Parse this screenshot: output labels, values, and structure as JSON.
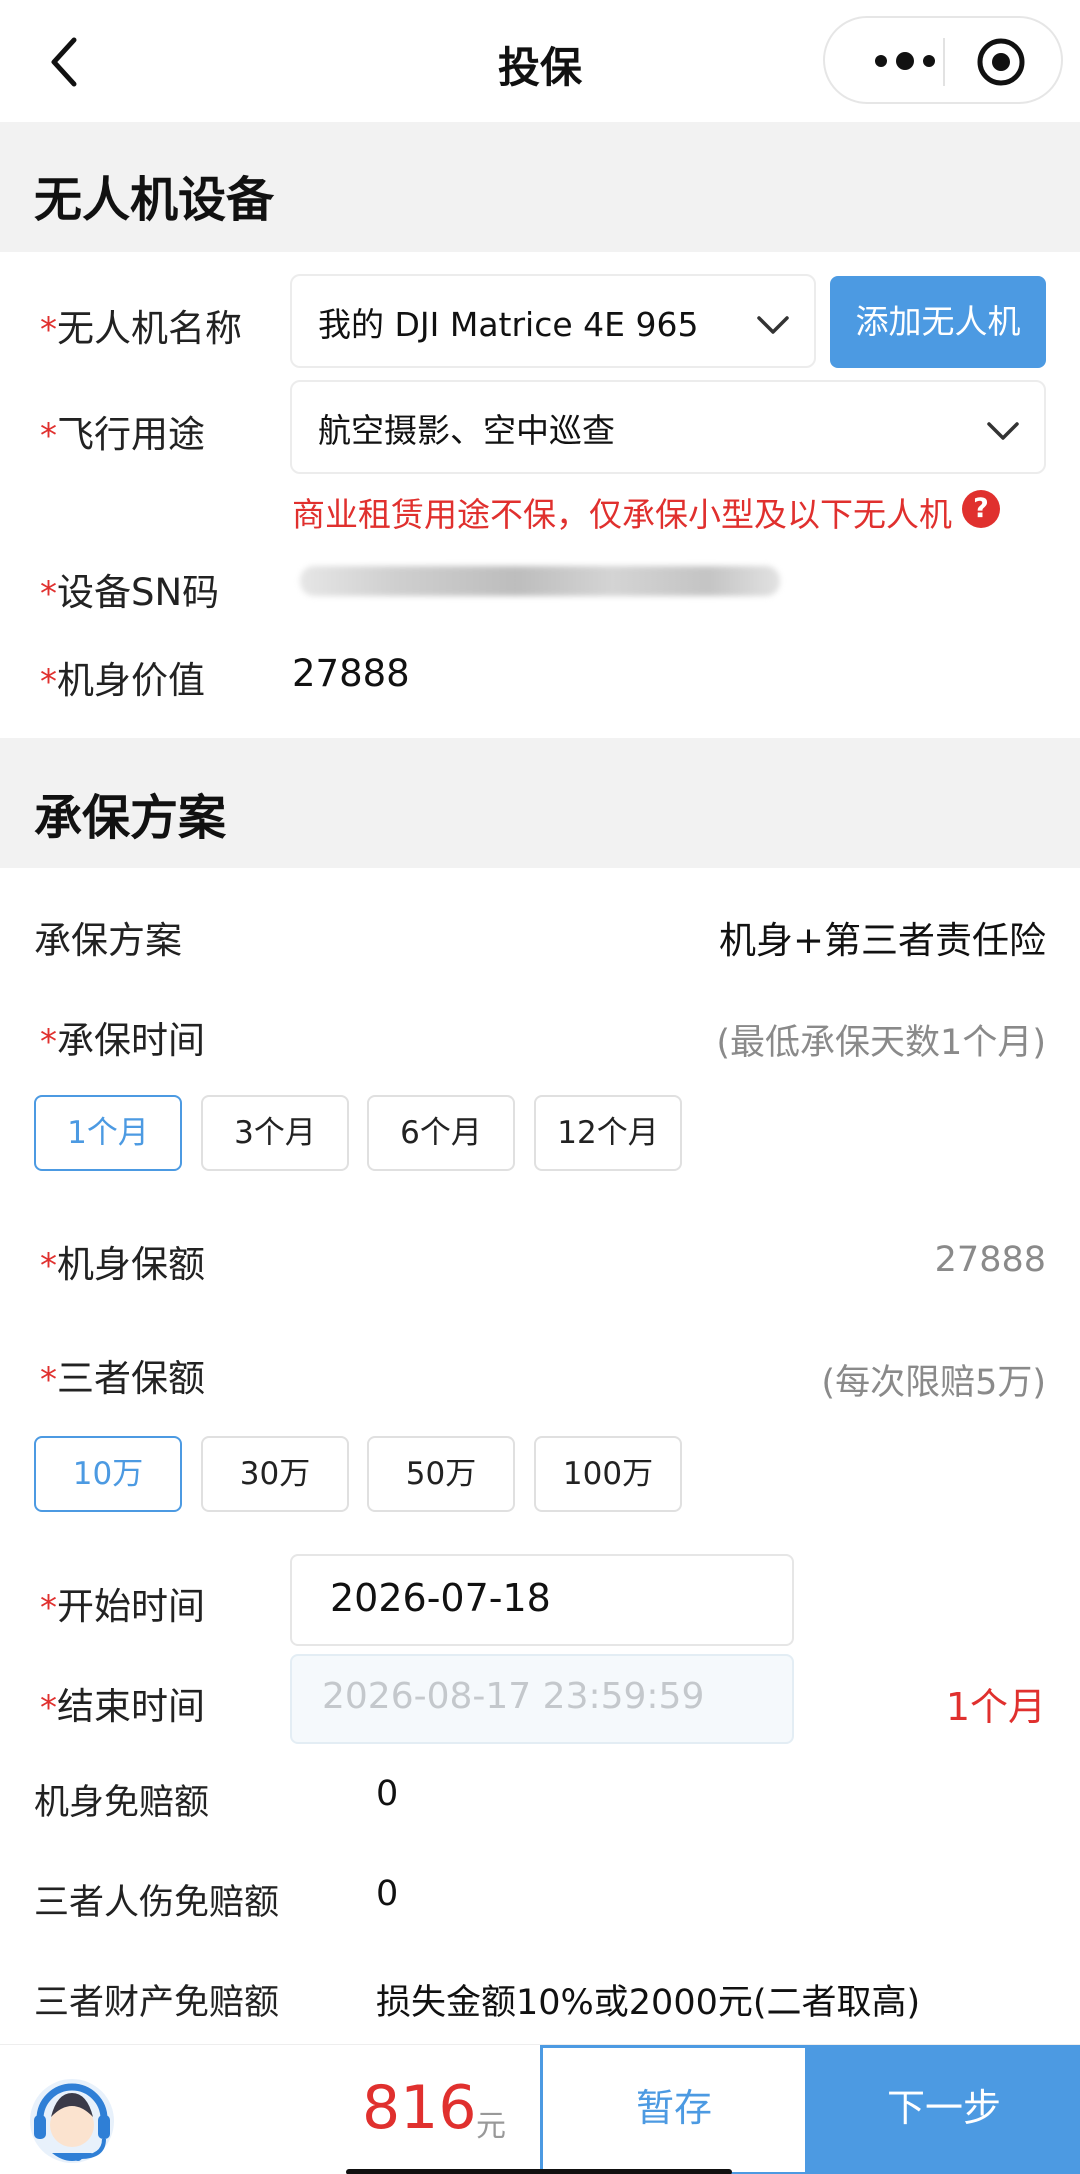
{
  "nav": {
    "title": "投保"
  },
  "device_section": {
    "title": "无人机设备",
    "star": "*",
    "name_label": "无人机名称",
    "name_value": "我的 DJI Matrice 4E 965",
    "add_button": "添加无人机",
    "purpose_label": "飞行用途",
    "purpose_value": "航空摄影、空中巡查",
    "purpose_warning": "商业租赁用途不保，仅承保小型及以下无人机",
    "help_icon_text": "?",
    "sn_label": "设备SN码",
    "value_label": "机身价值",
    "value_value": "27888"
  },
  "plan_section": {
    "title": "承保方案",
    "plan_label": "承保方案",
    "plan_value": "机身+第三者责任险",
    "period_label": "承保时间",
    "period_hint": "(最低承保天数1个月)",
    "period_options": [
      "1个月",
      "3个月",
      "6个月",
      "12个月"
    ],
    "hull_label": "机身保额",
    "hull_value": "27888",
    "third_label": "三者保额",
    "third_hint": "(每次限赔5万)",
    "third_options": [
      "10万",
      "30万",
      "50万",
      "100万"
    ],
    "start_label": "开始时间",
    "start_value": "2026-07-18",
    "end_label": "结束时间",
    "end_value": "2026-08-17 23:59:59",
    "duration": "1个月",
    "hull_deductible_label": "机身免赔额",
    "hull_deductible_value": "0",
    "injury_deductible_label": "三者人伤免赔额",
    "injury_deductible_value": "0",
    "property_deductible_label": "三者财产免赔额",
    "property_deductible_value": "损失金额10%或2000元(二者取高)"
  },
  "bottom": {
    "price": "816",
    "unit": "元",
    "save_label": "暂存",
    "next_label": "下一步"
  },
  "colors": {
    "accent": "#4c9ae2",
    "danger": "#e0302e",
    "section_bg": "#f2f2f2"
  }
}
